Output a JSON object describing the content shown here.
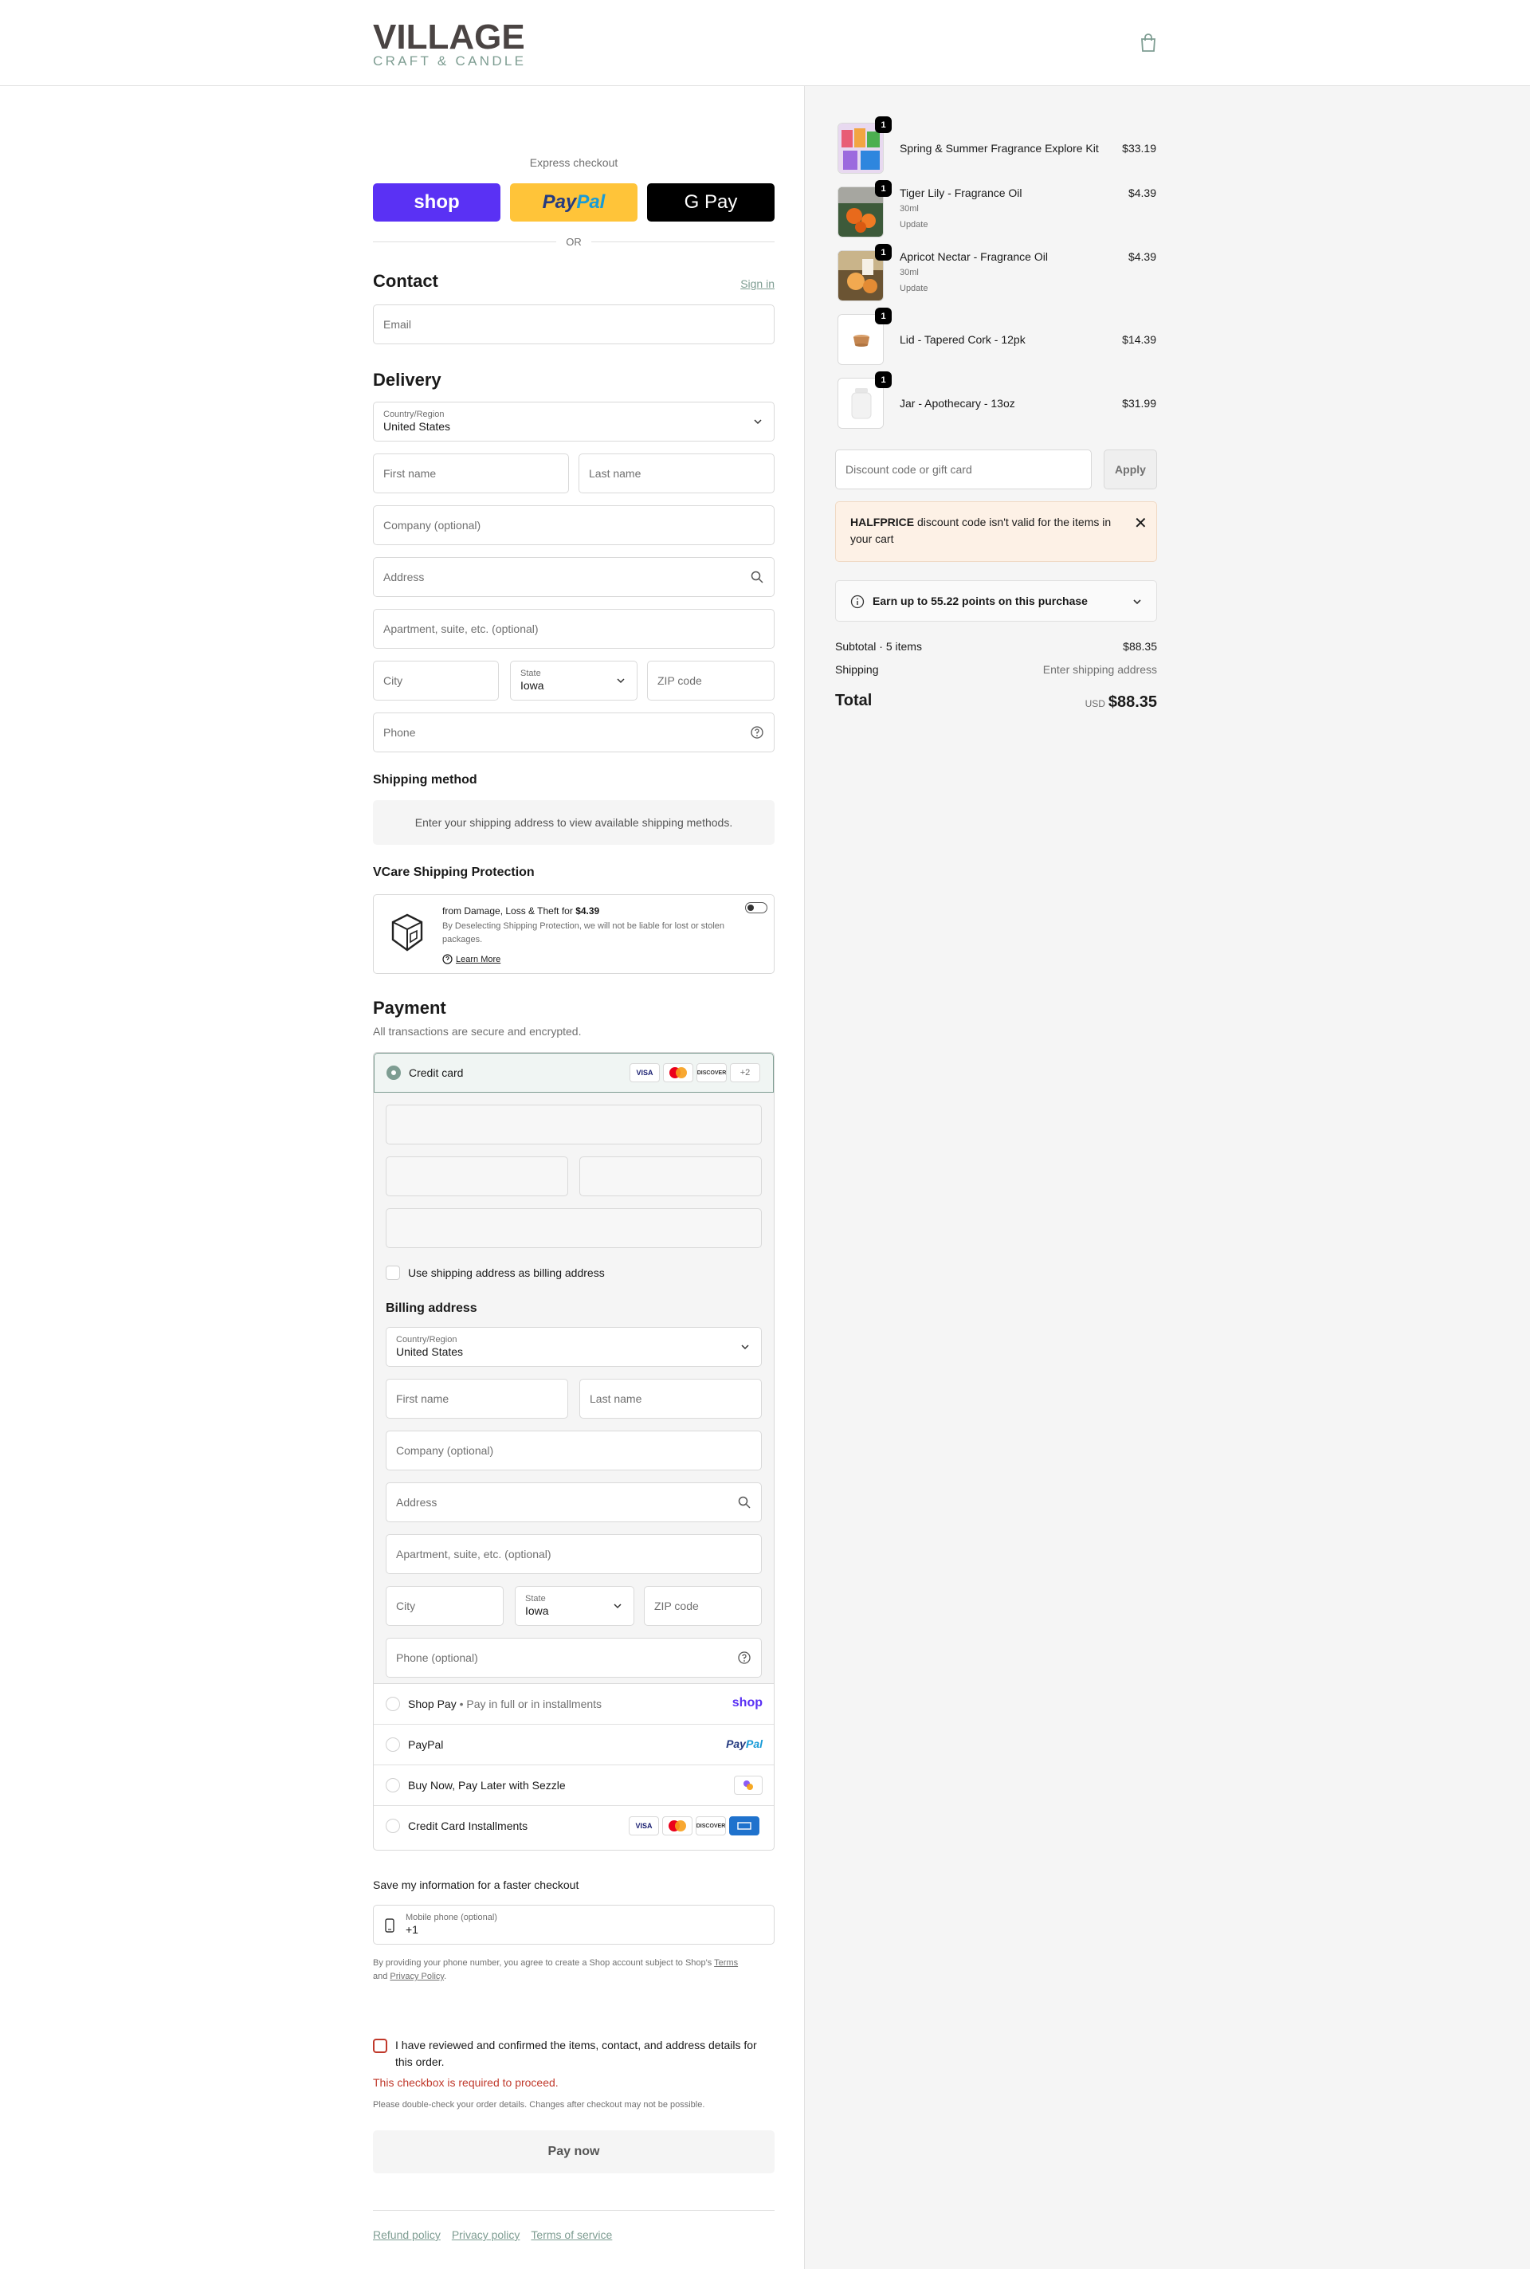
{
  "header": {
    "logo_main": "VILLAGE",
    "logo_sub": "CRAFT & CANDLE",
    "cart_icon": "shopping-bag-icon"
  },
  "express": {
    "label": "Express checkout",
    "shop_label": "shop",
    "paypal_a": "Pay",
    "paypal_b": "Pal",
    "gpay_label": "G Pay",
    "or_label": "OR"
  },
  "contact": {
    "title": "Contact",
    "sign_in": "Sign in",
    "email_placeholder": "Email"
  },
  "delivery": {
    "title": "Delivery",
    "country_label": "Country/Region",
    "country_value": "United States",
    "first_name": "First name",
    "last_name": "Last name",
    "company": "Company (optional)",
    "address": "Address",
    "apartment": "Apartment, suite, etc. (optional)",
    "city": "City",
    "state_label": "State",
    "state_value": "Iowa",
    "zip": "ZIP code",
    "phone": "Phone"
  },
  "shipping_method": {
    "title": "Shipping method",
    "message": "Enter your shipping address to view available shipping methods."
  },
  "protection": {
    "title": "VCare Shipping Protection",
    "line_prefix": "from Damage, Loss & Theft for ",
    "price": "$4.39",
    "description": "By Deselecting Shipping Protection, we will not be liable for lost or stolen packages.",
    "learn_more": "Learn More"
  },
  "payment": {
    "title": "Payment",
    "subtitle": "All transactions are secure and encrypted.",
    "credit_card": "Credit card",
    "cards": [
      "VISA",
      "MC",
      "DISCOVER"
    ],
    "more_cards": "+2",
    "use_shipping": "Use shipping address as billing address",
    "billing_title": "Billing address",
    "billing": {
      "country_label": "Country/Region",
      "country_value": "United States",
      "first_name": "First name",
      "last_name": "Last name",
      "company": "Company (optional)",
      "address": "Address",
      "apartment": "Apartment, suite, etc. (optional)",
      "city": "City",
      "state_label": "State",
      "state_value": "Iowa",
      "zip": "ZIP code",
      "phone": "Phone (optional)"
    },
    "shop_pay": "Shop Pay",
    "shop_pay_sub": "Pay in full or in installments",
    "shop_logo": "shop",
    "paypal": "PayPal",
    "sezzle": "Buy Now, Pay Later with Sezzle",
    "installments": "Credit Card Installments"
  },
  "save_info": {
    "title": "Save my information for a faster checkout",
    "mobile_label": "Mobile phone (optional)",
    "mobile_value": "+1",
    "disclaimer_a": "By providing your phone number, you agree to create a Shop account subject to Shop's ",
    "terms": "Terms",
    "and": "and ",
    "privacy": "Privacy Policy",
    "period": "."
  },
  "confirm": {
    "label": "I have reviewed and confirmed the items, contact, and address details for this order.",
    "error": "This checkbox is required to proceed.",
    "note": "Please double-check your order details. Changes after checkout may not be possible.",
    "pay_now": "Pay now"
  },
  "footer": {
    "links": [
      "Refund policy",
      "Privacy policy",
      "Terms of service"
    ]
  },
  "cart": {
    "items": [
      {
        "name": "Spring & Summer Fragrance Explore Kit",
        "qty": "1",
        "price": "$33.19",
        "meta": []
      },
      {
        "name": "Tiger Lily - Fragrance Oil",
        "qty": "1",
        "price": "$4.39",
        "meta": [
          "30ml",
          "Update"
        ]
      },
      {
        "name": "Apricot Nectar - Fragrance Oil",
        "qty": "1",
        "price": "$4.39",
        "meta": [
          "30ml",
          "Update"
        ]
      },
      {
        "name": "Lid - Tapered Cork - 12pk",
        "qty": "1",
        "price": "$14.39",
        "meta": []
      },
      {
        "name": "Jar - Apothecary - 13oz",
        "qty": "1",
        "price": "$31.99",
        "meta": []
      }
    ],
    "discount_placeholder": "Discount code or gift card",
    "apply": "Apply",
    "alert_code": "HALFPRICE",
    "alert_text": " discount code isn't valid for the items in your cart",
    "earn": "Earn up to 55.22 points on this purchase",
    "subtotal_label": "Subtotal · 5 items",
    "subtotal_value": "$88.35",
    "shipping_label": "Shipping",
    "shipping_value": "Enter shipping address",
    "total_label": "Total",
    "currency": "USD",
    "total_value": "$88.35"
  },
  "colors": {
    "accent": "#7e9d92",
    "shop_purple": "#5a31f4",
    "paypal_yellow": "#ffc439",
    "error": "#c0392b"
  }
}
